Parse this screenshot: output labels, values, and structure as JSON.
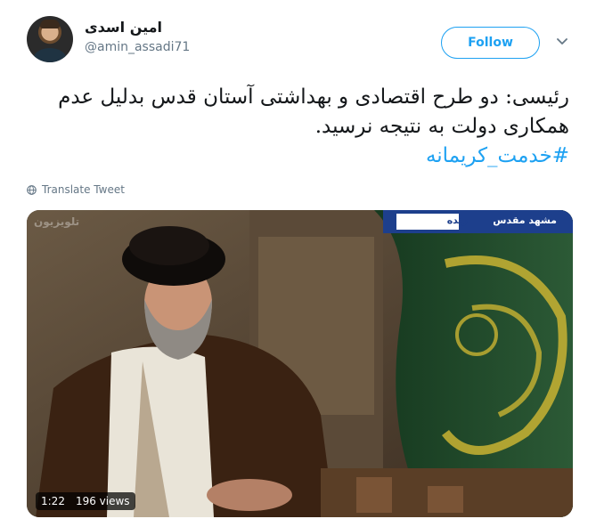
{
  "user": {
    "name": "امین اسدی",
    "handle": "@amin_assadi71"
  },
  "follow_label": "Follow",
  "tweet": {
    "line1": "رئیسی: دو طرح اقتصادی و بهداشتی آستان قدس بدلیل عدم",
    "line2": "همکاری دولت به نتیجه نرسید.",
    "hashtag": "#خدمت_کریمانه"
  },
  "translate_label": "Translate Tweet",
  "video": {
    "duration": "1:22",
    "views": "196 views",
    "overlay": {
      "location": "مشهد مقدس",
      "live": "زنده",
      "channel_logo": "تلویزیون"
    }
  },
  "colors": {
    "accent": "#1da1f2",
    "text": "#14171a",
    "secondary": "#657786",
    "flag_green": "#1f4a2c",
    "flag_gold": "#c9b332",
    "banner_blue": "#1d3f8c"
  },
  "icons": {
    "more": "chevron-down-icon",
    "translate": "globe-icon"
  }
}
